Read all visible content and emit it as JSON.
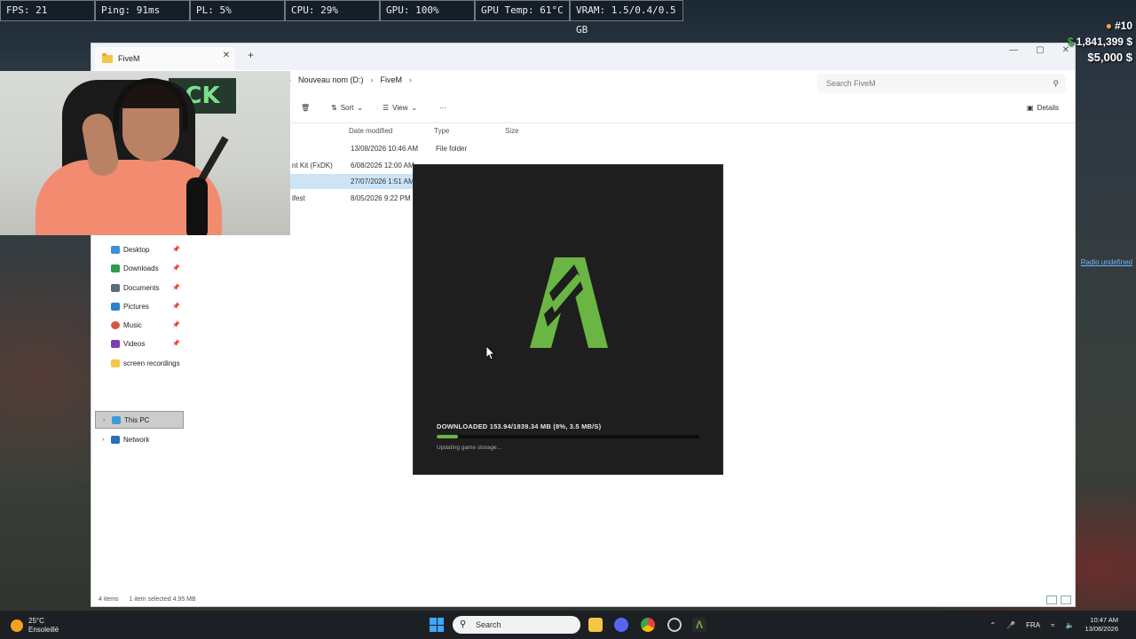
{
  "perf_overlay": {
    "cells": [
      "FPS: 21",
      "Ping: 91ms",
      "PL: 5%",
      "CPU: 29%",
      "GPU: 100%",
      "GPU Temp: 61°C",
      "VRAM: 1.5/0.4/0.5 GB"
    ]
  },
  "hud": {
    "rank": "#10",
    "money": "1,841,399 $",
    "bank": "5,000 $",
    "radio_link": "Radio undefined"
  },
  "explorer": {
    "tab_title": "FiveM",
    "breadcrumb": [
      "Nouveau nom (D:)",
      "FiveM"
    ],
    "search_placeholder": "Search FiveM",
    "toolbar": {
      "sort_label": "Sort",
      "view_label": "View",
      "more_label": "···",
      "details_label": "Details"
    },
    "columns": {
      "date_modified": "Date modified",
      "type": "Type",
      "size": "Size"
    },
    "rows": [
      {
        "name": "",
        "date": "13/08/2026 10:46 AM",
        "type": "File folder"
      },
      {
        "name": "nt Kit (FxDK)",
        "date": "6/08/2026 12:00 AM",
        "type": ""
      },
      {
        "name": "",
        "date": "27/07/2026 1:51 AM",
        "type": ""
      },
      {
        "name": "ifest",
        "date": "8/05/2026 9:22 PM",
        "type": ""
      }
    ],
    "sidebar": [
      {
        "label": "Desktop",
        "icon": "desktop-icon",
        "color": "#3b8fd6"
      },
      {
        "label": "Downloads",
        "icon": "download-icon",
        "color": "#2e9a4a"
      },
      {
        "label": "Documents",
        "icon": "documents-icon",
        "color": "#5a6b7c"
      },
      {
        "label": "Pictures",
        "icon": "pictures-icon",
        "color": "#2f7fd0"
      },
      {
        "label": "Music",
        "icon": "music-icon",
        "color": "#d6553f"
      },
      {
        "label": "Videos",
        "icon": "videos-icon",
        "color": "#7b3fb3"
      },
      {
        "label": "screen recordings",
        "icon": "folder-icon",
        "color": "#f3c646"
      }
    ],
    "tree": [
      {
        "label": "This PC",
        "icon": "pc-icon"
      },
      {
        "label": "Network",
        "icon": "network-icon"
      }
    ],
    "status": {
      "items": "4 items",
      "selected": "1 item selected  4.95 MB"
    }
  },
  "loader": {
    "download_text": "DOWNLOADED 153.94/1839.34 MB (8%, 3.5 MB/S)",
    "progress": 0.08,
    "sub_text": "Updating game storage...",
    "accent": "#6ab544"
  },
  "taskbar": {
    "temperature": "25°C",
    "weather": "Ensoleillé",
    "search_label": "Search",
    "language": "FRA",
    "time": "10:47 AM",
    "date": "13/08/2026"
  }
}
